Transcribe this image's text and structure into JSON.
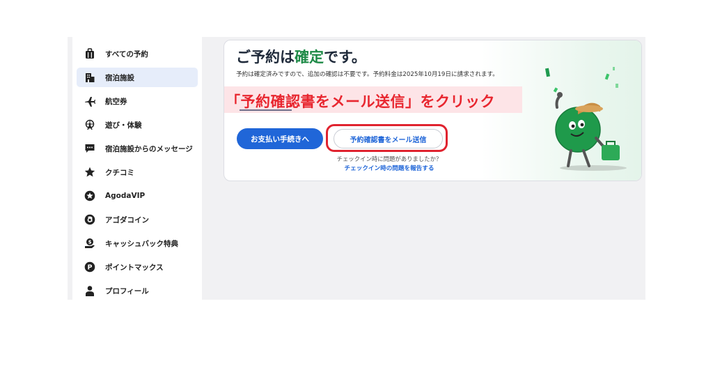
{
  "sidebar": {
    "items": [
      {
        "label": "すべての予約",
        "icon": "suitcase-icon",
        "active": false
      },
      {
        "label": "宿泊施設",
        "icon": "building-icon",
        "active": true
      },
      {
        "label": "航空券",
        "icon": "airplane-icon",
        "active": false
      },
      {
        "label": "遊び・体験",
        "icon": "ferris-wheel-icon",
        "active": false
      },
      {
        "label": "宿泊施設からのメッセージ",
        "icon": "chat-bubble-icon",
        "active": false
      },
      {
        "label": "クチコミ",
        "icon": "star-icon",
        "active": false
      },
      {
        "label": "AgodaVIP",
        "icon": "star-circle-icon",
        "active": false
      },
      {
        "label": "アゴダコイン",
        "icon": "coin-icon",
        "active": false
      },
      {
        "label": "キャッシュバック特典",
        "icon": "cashback-icon",
        "active": false
      },
      {
        "label": "ポイントマックス",
        "icon": "pointmax-icon",
        "active": false
      },
      {
        "label": "プロフィール",
        "icon": "person-icon",
        "active": false
      }
    ]
  },
  "confirmation": {
    "title_prefix": "ご予約は",
    "title_accent": "確定",
    "title_suffix": "です。",
    "subtitle": "予約は確定済みですので、追加の確認は不要です。予約料金は2025年10月19日に請求されます。",
    "annotation": "「予約確認書をメール送信」をクリック",
    "pay_button_label": "お支払い手続きへ",
    "email_button_label": "予約確認書をメール送信",
    "checkin_question": "チェックイン時に問題がありましたか？",
    "report_link": "チェックイン時の問題を報告する"
  },
  "colors": {
    "brand_blue": "#2066d8",
    "confirm_green": "#1e8a47",
    "annotation_red": "#e8262f"
  }
}
